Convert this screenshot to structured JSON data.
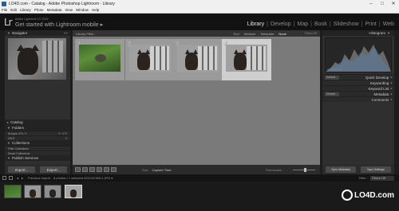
{
  "window": {
    "title": "LO4D.com - Catalog - Adobe Photoshop Lightroom - Library",
    "buttons": [
      "–",
      "□",
      "✕"
    ]
  },
  "menu": [
    "File",
    "Edit",
    "Library",
    "Photo",
    "Metadata",
    "View",
    "Window",
    "Help"
  ],
  "identity": {
    "logo": "Lr",
    "subtitle": "Adobe Lightroom CC 2015",
    "tagline": "Get started with Lightroom mobile",
    "chevron": "▸"
  },
  "modules": [
    {
      "label": "Library",
      "active": true
    },
    {
      "label": "Develop",
      "active": false
    },
    {
      "label": "Map",
      "active": false
    },
    {
      "label": "Book",
      "active": false
    },
    {
      "label": "Slideshow",
      "active": false
    },
    {
      "label": "Print",
      "active": false
    },
    {
      "label": "Web",
      "active": false
    }
  ],
  "module_separator": "|",
  "left": {
    "navigator": {
      "label": "Navigator",
      "right": "FIT"
    },
    "catalog": "Catalog",
    "folders": "Folders",
    "volume": {
      "name": "Scorpio 470 / 1",
      "info": "6 / 470"
    },
    "folder": {
      "name": "2013",
      "count": "6"
    },
    "collections": "Collections",
    "filter_collections": "Filter Collections",
    "smart_collections": "Smart Collections",
    "publish_services": "Publish Services",
    "import_button": "Import...",
    "export_button": "Export..."
  },
  "filter_bar": {
    "title": "Library Filter :",
    "options": [
      {
        "label": "Text",
        "active": false
      },
      {
        "label": "Attribute",
        "active": false
      },
      {
        "label": "Metadata",
        "active": false
      },
      {
        "label": "None",
        "active": true
      }
    ],
    "filters_off": "Filters Off"
  },
  "grid": [
    {
      "num": "1",
      "selected": false,
      "kind": "bird"
    },
    {
      "num": "2",
      "selected": false,
      "kind": "cat"
    },
    {
      "num": "3",
      "selected": false,
      "kind": "cat"
    },
    {
      "num": "4",
      "selected": true,
      "kind": "cat"
    }
  ],
  "toolbar": {
    "sort_label": "Sort:",
    "sort_value": "Capture Time",
    "thumbnails": "Thumbnails"
  },
  "right": {
    "histogram": "Histogram",
    "histo_info": "Original Photo",
    "quick_develop": {
      "label": "Quick Develop",
      "select": "Default"
    },
    "keywording": "Keywording",
    "keyword_list": "Keyword List",
    "metadata": {
      "label": "Metadata",
      "select": "Default"
    },
    "comments": "Comments",
    "sync_metadata": "Sync Metadata",
    "sync_settings": "Sync Settings"
  },
  "filmstrip_bar": {
    "nav_prev": "◂",
    "nav_next": "▸",
    "source": "Previous Import",
    "summary": "6 photos / 1 selected /DSC02158-2.JPG ▾",
    "filter_label": "Filter :",
    "filter_value": "Filters Off"
  },
  "watermark": "LO4D.com"
}
